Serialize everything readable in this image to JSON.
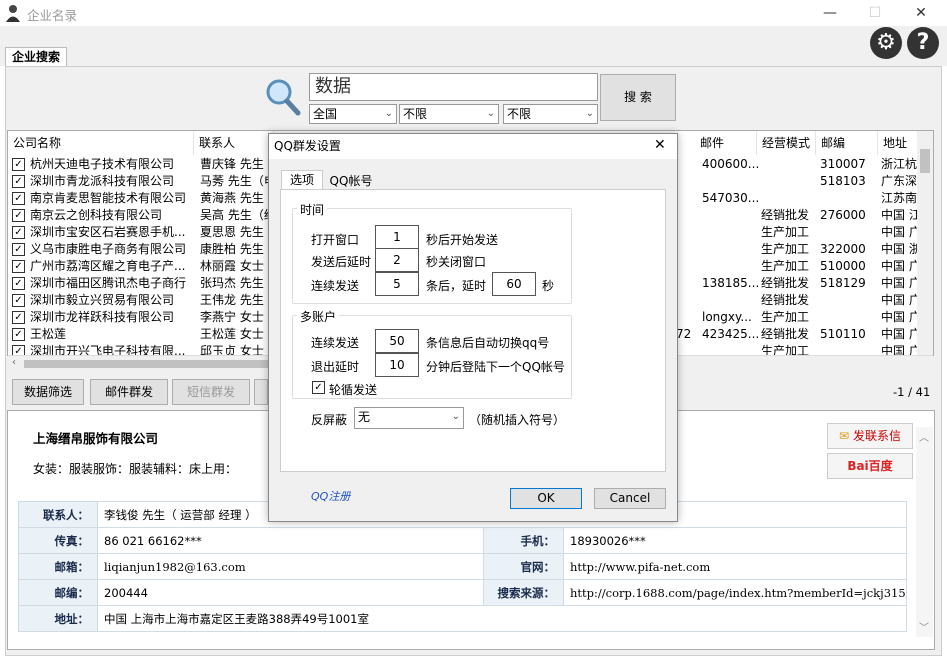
{
  "window": {
    "title": "企业名录",
    "minimize": "—",
    "maximize": "☐",
    "close": "✕"
  },
  "tabs": {
    "active": "企业搜索"
  },
  "search": {
    "value": "数据",
    "button": "搜 索",
    "region": "全国",
    "filter1": "不限",
    "filter2": "不限"
  },
  "table": {
    "headers": [
      "公司名称",
      "联系人",
      "",
      "",
      "",
      "",
      "",
      "邮件",
      "经营模式",
      "邮编",
      "地址"
    ],
    "rows": [
      {
        "company": "杭州天迪电子技术有限公司",
        "contact": "曹庆锋 先生",
        "email": "400600...",
        "mode": "",
        "zip": "310007",
        "addr": "浙江杭"
      },
      {
        "company": "深圳市青龙派科技有限公司",
        "contact": "马莠 先生（电",
        "email": "",
        "mode": "",
        "zip": "518103",
        "addr": "广东深"
      },
      {
        "company": "南京肯麦思智能技术有限公司",
        "contact": "黄海燕 先生",
        "email": "547030...",
        "mode": "",
        "zip": "",
        "addr": "江苏南"
      },
      {
        "company": "南京云之创科技有限公司",
        "contact": "吴高 先生（经",
        "email": "",
        "mode": "经销批发",
        "zip": "276000",
        "addr": "中国 江"
      },
      {
        "company": "深圳市宝安区石岩赛恩手机...",
        "contact": "夏思恩 先生",
        "email": "",
        "mode": "生产加工",
        "zip": "",
        "addr": "中国 广"
      },
      {
        "company": "义乌市康胜电子商务有限公司",
        "contact": "康胜柏 先生",
        "email": "",
        "mode": "生产加工",
        "zip": "322000",
        "addr": "中国 浙"
      },
      {
        "company": "广州市荔湾区耀之育电子产...",
        "contact": "林丽霞 女士",
        "email": "",
        "mode": "生产加工",
        "zip": "510000",
        "addr": "中国 广"
      },
      {
        "company": "深圳市福田区腾讯杰电子商行",
        "contact": "张玛杰 先生",
        "email": "138185...",
        "mode": "经销批发",
        "zip": "518129",
        "addr": "中国 广"
      },
      {
        "company": "深圳市毅立兴贸易有限公司",
        "contact": "王伟龙 先生",
        "email": "",
        "mode": "经销批发",
        "zip": "",
        "addr": "中国 广"
      },
      {
        "company": "深圳市龙祥跃科技有限公司",
        "contact": "李燕宁 女士",
        "email": "longxy...",
        "mode": "生产加工",
        "zip": "",
        "addr": "中国 广"
      },
      {
        "company": "王松莲",
        "contact": "王松莲 女士",
        "extra": "72",
        "email": "423425...",
        "mode": "经销批发",
        "zip": "510110",
        "addr": "中国 广"
      },
      {
        "company": "深圳市开兴飞电子科技有限...",
        "contact": "邱玉贞 女士",
        "email": "",
        "mode": "生产加工",
        "zip": "",
        "addr": "中国 广"
      }
    ]
  },
  "bottom": {
    "filter": "数据筛选",
    "mail": "邮件群发",
    "sms": "短信群发",
    "pager": "-1 / 41"
  },
  "detail": {
    "company": "上海缙帛服饰有限公司",
    "industry": "女装：服装服饰：服装辅料：床上用：",
    "send_btn": "发联系信",
    "baidu": "Bai百度",
    "contact_label": "联系人：",
    "contact": "李钱俊 先生（ 运营部 经理 ）",
    "fax_label": "传真：",
    "fax": "86 021 66162***",
    "mobile_label": "手机：",
    "mobile": "18930026***",
    "email_label": "邮箱：",
    "email": "liqianjun1982@163.com",
    "site_label": "官网：",
    "site": "http://www.pifa-net.com",
    "zip_label": "邮编：",
    "zip": "200444",
    "source_label": "搜索来源：",
    "source": "http://corp.1688.com/page/index.htm?memberId=jckj315",
    "addr_label": "地址：",
    "addr": "中国 上海市上海市嘉定区王麦路388弄49号1001室"
  },
  "dialog": {
    "title": "QQ群发设置",
    "tab1": "选项",
    "tab2": "QQ帐号",
    "group_time": "时间",
    "open_label": "打开窗口",
    "open_value": "1",
    "open_suffix": "秒后开始发送",
    "delay_label": "发送后延时",
    "delay_value": "2",
    "delay_suffix": "秒关闭窗口",
    "cont_label": "连续发送",
    "cont_value": "5",
    "cont_mid": "条后，延时",
    "cont_value2": "60",
    "cont_suffix": "秒",
    "group_multi": "多账户",
    "multi_label": "连续发送",
    "multi_value": "50",
    "multi_suffix": "条信息后自动切换qq号",
    "exit_label": "退出延时",
    "exit_value": "10",
    "exit_suffix": "分钟后登陆下一个QQ帐号",
    "loop_label": "轮循发送",
    "shield_label": "反屏蔽",
    "shield_value": "无",
    "shield_suffix": "（随机插入符号）",
    "qq_register": "QQ注册",
    "ok": "OK",
    "cancel": "Cancel"
  }
}
